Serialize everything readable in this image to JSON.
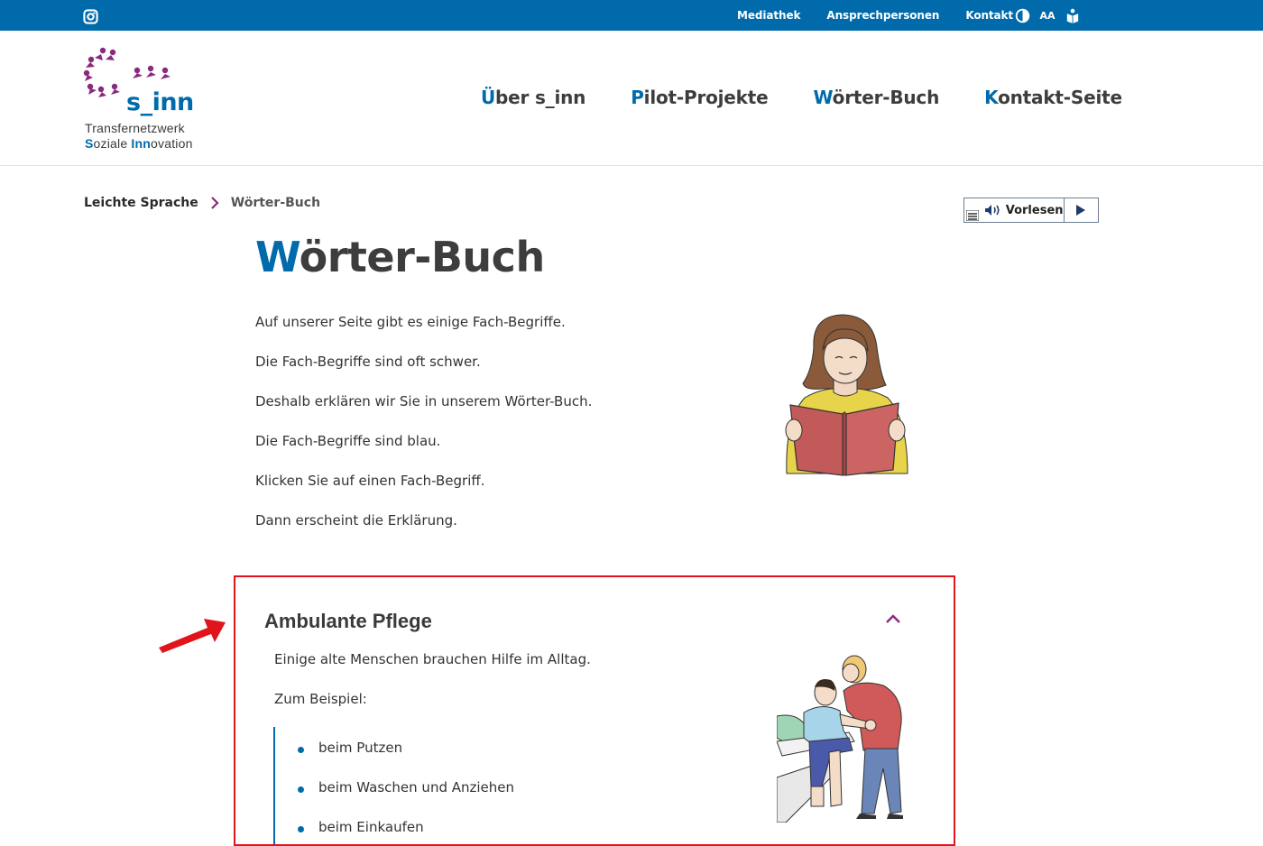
{
  "topbar": {
    "links": [
      "Mediathek",
      "Ansprechpersonen",
      "Kontakt"
    ],
    "font_size_label": "AA"
  },
  "logo": {
    "brand": "s_inn",
    "line1": "Transfernetzwerk",
    "line2_s": "S",
    "line2_a": "oziale ",
    "line2_inn": "Inn",
    "line2_b": "ovation"
  },
  "nav": [
    {
      "first": "Ü",
      "rest": "ber s_inn"
    },
    {
      "first": "P",
      "rest": "ilot-Projekte"
    },
    {
      "first": "W",
      "rest": "örter-Buch"
    },
    {
      "first": "K",
      "rest": "ontakt-Seite"
    }
  ],
  "breadcrumb": {
    "home": "Leichte Sprache",
    "current": "Wörter-Buch"
  },
  "readspeaker": {
    "label": "Vorlesen"
  },
  "page": {
    "title_first": "W",
    "title_rest": "örter-Buch",
    "intro": [
      "Auf unserer Seite gibt es einige Fach-Begriffe.",
      "Die Fach-Begriffe sind oft schwer.",
      "Deshalb erklären wir Sie in unserem Wörter-Buch.",
      "Die Fach-Begriffe sind blau.",
      "Klicken Sie auf einen Fach-Begriff.",
      "Dann erscheint die Erklärung."
    ]
  },
  "accordion": {
    "title": "Ambulante Pflege",
    "text1": "Einige alte Menschen brauchen Hilfe im Alltag.",
    "text2": "Zum Beispiel:",
    "items": [
      "beim Putzen",
      "beim Waschen und Anziehen",
      "beim Einkaufen"
    ]
  },
  "colors": {
    "brand_blue": "#006aab",
    "brand_purple": "#8a2a7e",
    "highlight_red": "#e1131b"
  }
}
